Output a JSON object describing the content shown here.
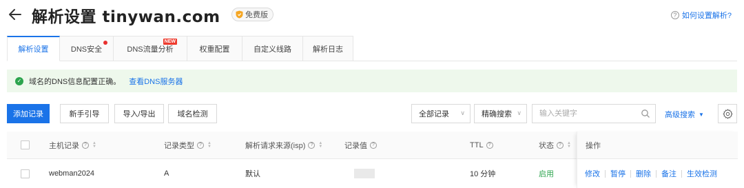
{
  "header": {
    "title": "解析设置 tinywan.com",
    "edition_badge": "免费版",
    "help_link": "如何设置解析?"
  },
  "tabs": [
    {
      "label": "解析设置",
      "active": true
    },
    {
      "label": "DNS安全",
      "dot": true
    },
    {
      "label": "DNS流量分析",
      "badge": "NEW"
    },
    {
      "label": "权重配置"
    },
    {
      "label": "自定义线路"
    },
    {
      "label": "解析日志"
    }
  ],
  "alert": {
    "text": "域名的DNS信息配置正确。",
    "link": "查看DNS服务器"
  },
  "toolbar": {
    "add_record": "添加记录",
    "guide": "新手引导",
    "import_export": "导入/导出",
    "domain_check": "域名检测",
    "record_filter": "全部记录",
    "search_mode": "精确搜索",
    "search_placeholder": "输入关键字",
    "advanced_search": "高级搜索"
  },
  "table": {
    "columns": {
      "host": "主机记录",
      "type": "记录类型",
      "isp": "解析请求来源(isp)",
      "value": "记录值",
      "ttl": "TTL",
      "status": "状态",
      "ops": "操作"
    },
    "rows": [
      {
        "host": "webman2024",
        "type": "A",
        "isp": "默认",
        "ttl": "10 分钟",
        "status": "启用",
        "ops": [
          "修改",
          "暂停",
          "删除",
          "备注",
          "生效检测"
        ]
      }
    ]
  },
  "colors": {
    "accent": "#1a73e8",
    "success": "#2da44e",
    "alert_bg": "#eef8ec",
    "badge_red": "#ee3b2e"
  }
}
